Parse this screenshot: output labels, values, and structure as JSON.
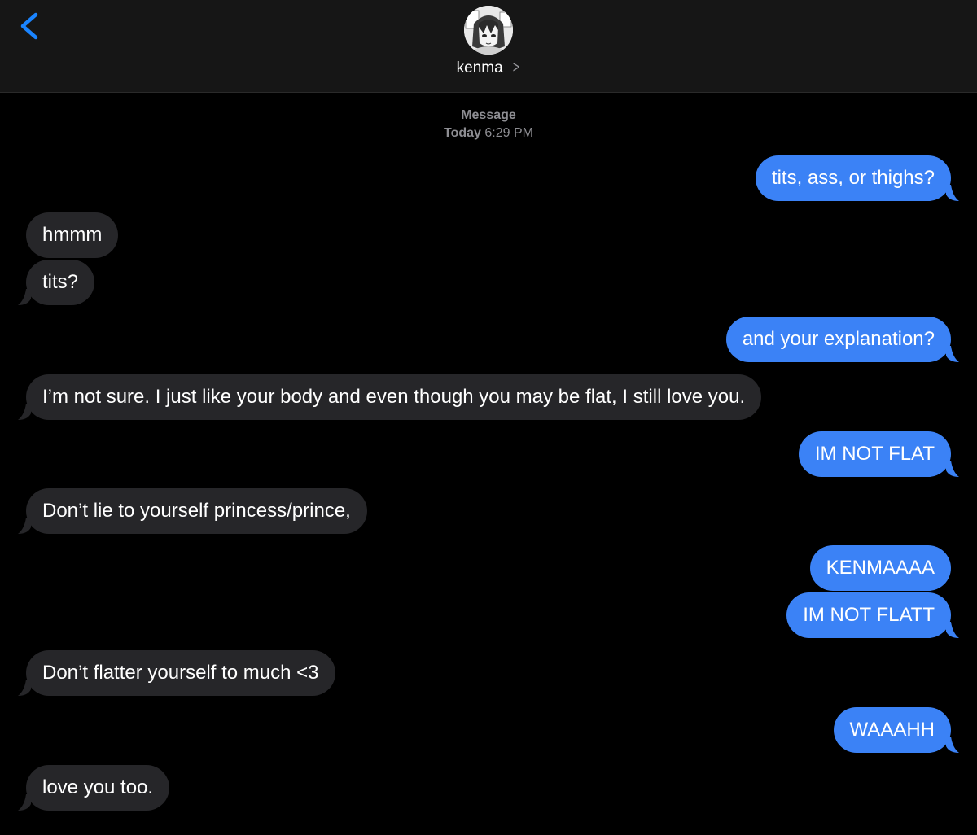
{
  "header": {
    "contact_name": "kenma",
    "back_icon": "chevron-left-icon",
    "detail_icon": "chevron-right-icon"
  },
  "thread": {
    "service": "Message",
    "day": "Today",
    "time": "6:29 PM"
  },
  "messages": [
    {
      "from": "me",
      "text": "tits, ass, or thighs?"
    },
    {
      "from": "them",
      "text": "hmmm"
    },
    {
      "from": "them",
      "text": "tits?"
    },
    {
      "from": "me",
      "text": "and your explanation?"
    },
    {
      "from": "them",
      "text": "I’m not sure. I just like your body and even though you may be flat, I still love you."
    },
    {
      "from": "me",
      "text": "IM NOT FLAT"
    },
    {
      "from": "them",
      "text": "Don’t lie to yourself princess/prince,"
    },
    {
      "from": "me",
      "text": "KENMAAAA"
    },
    {
      "from": "me",
      "text": "IM NOT FLATT"
    },
    {
      "from": "them",
      "text": "Don’t flatter yourself to much <3"
    },
    {
      "from": "me",
      "text": "WAAAHH"
    },
    {
      "from": "them",
      "text": "love you too."
    }
  ],
  "colors": {
    "background": "#000000",
    "header": "#161616",
    "sent_bubble": "#3b82f6",
    "received_bubble": "#262629",
    "accent": "#1a84ff",
    "meta_text": "#8e8e93"
  }
}
